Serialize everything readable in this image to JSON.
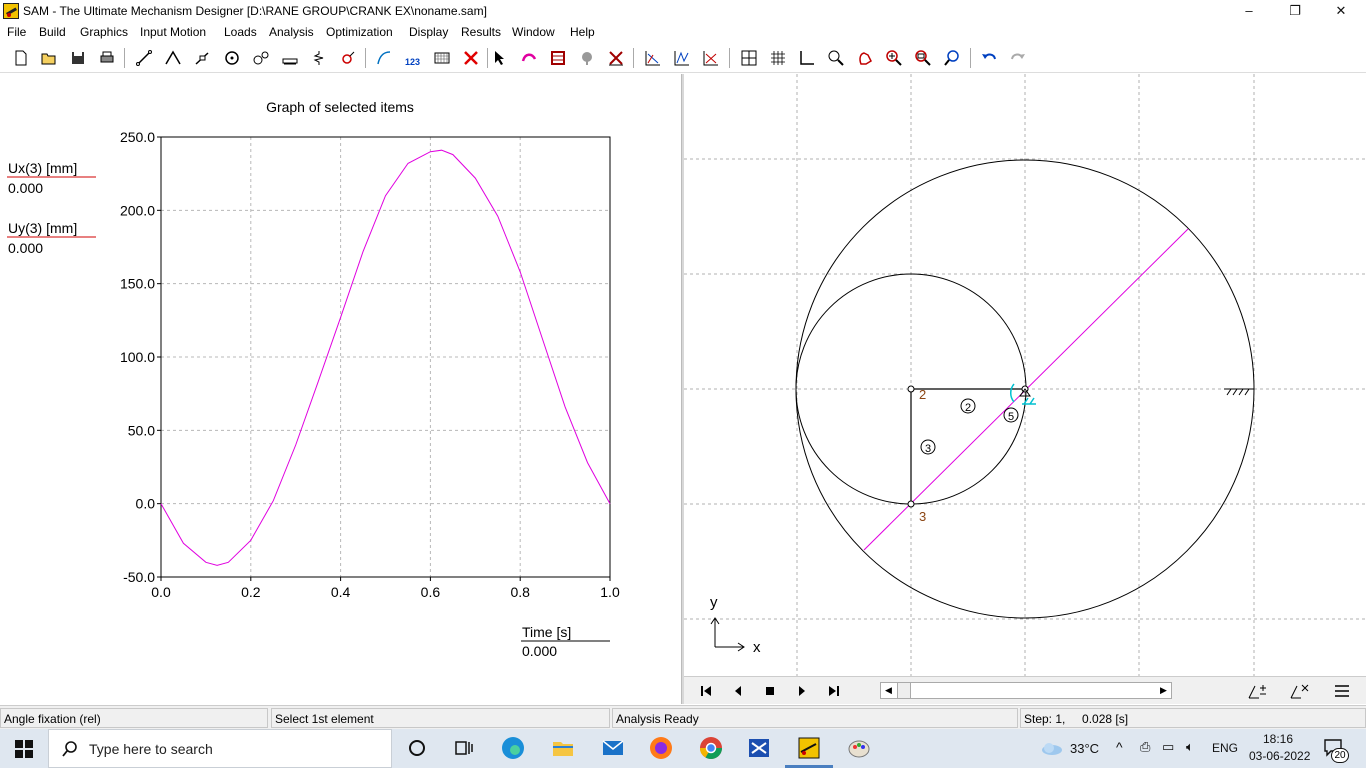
{
  "window": {
    "title": "SAM - The Ultimate Mechanism Designer [D:\\RANE GROUP\\CRANK EX\\noname.sam]",
    "minimize": "–",
    "maximize": "❐",
    "close": "✕"
  },
  "menu": [
    "File",
    "Build",
    "Graphics",
    "Input Motion",
    "Loads",
    "Analysis",
    "Optimization",
    "Display",
    "Results",
    "Window",
    "Help"
  ],
  "toolbar_icons": [
    "new-file-icon",
    "open-folder-icon",
    "save-icon",
    "print-icon",
    "beam-element-icon",
    "truss-element-icon",
    "slider-element-icon",
    "hinge-icon",
    "gear-pair-icon",
    "belt-icon",
    "spring-icon",
    "damper-icon",
    "curve-icon",
    "numbering-icon",
    "grid-pattern-icon",
    "delete-icon",
    "select-arrow-icon",
    "motion-icon",
    "frame-icon",
    "mass-icon",
    "anchor-icon",
    "graph-x-icon",
    "graph-y-icon",
    "graph-xy-icon",
    "crosshair-icon",
    "grid-icon",
    "measure-icon",
    "zoom-icon",
    "pan-icon",
    "zoom-in-icon",
    "zoom-fit-icon",
    "zoom-window-icon",
    "undo-icon",
    "redo-icon"
  ],
  "graph": {
    "title": "Graph of selected items",
    "legend": [
      {
        "label": "Ux(3) [mm]",
        "value": "0.000",
        "color": "#d00000"
      },
      {
        "label": "Uy(3) [mm]",
        "value": "0.000",
        "color": "#d00000"
      }
    ],
    "xaxis_label": "Time [s]",
    "xaxis_value": "0.000"
  },
  "chart_data": {
    "type": "line",
    "title": "Graph of selected items",
    "xlabel": "Time [s]",
    "ylabel": "",
    "xlim": [
      0.0,
      1.0
    ],
    "ylim": [
      -50.0,
      250.0
    ],
    "xticks": [
      "0.0",
      "0.2",
      "0.4",
      "0.6",
      "0.8",
      "1.0"
    ],
    "yticks": [
      "-50.0",
      "0.0",
      "50.0",
      "100.0",
      "150.0",
      "200.0",
      "250.0"
    ],
    "grid": true,
    "series": [
      {
        "name": "Uy(3) [mm]",
        "color": "#e000e0",
        "x": [
          0.0,
          0.05,
          0.1,
          0.125,
          0.15,
          0.2,
          0.25,
          0.3,
          0.35,
          0.4,
          0.45,
          0.5,
          0.55,
          0.6,
          0.625,
          0.65,
          0.7,
          0.75,
          0.8,
          0.85,
          0.9,
          0.95,
          1.0
        ],
        "y": [
          0.0,
          -27,
          -40,
          -42,
          -40,
          -25,
          2,
          40,
          83,
          127,
          172,
          210,
          232,
          240,
          241,
          238,
          222,
          196,
          158,
          112,
          66,
          28,
          0.0
        ]
      }
    ]
  },
  "mechanism": {
    "node_labels": [
      "2",
      "3"
    ],
    "element_labels": [
      "2",
      "3",
      "5"
    ],
    "axis_x": "x",
    "axis_y": "y"
  },
  "status": {
    "s1": "Angle fixation (rel)",
    "s2": "Select 1st element",
    "s3": "Analysis Ready",
    "s4": "Step: 1,     0.028 [s]"
  },
  "taskbar": {
    "search_placeholder": "Type here to search",
    "weather": "33°C",
    "lang": "ENG",
    "time": "18:16",
    "date": "03-06-2022",
    "notifications": "20"
  }
}
